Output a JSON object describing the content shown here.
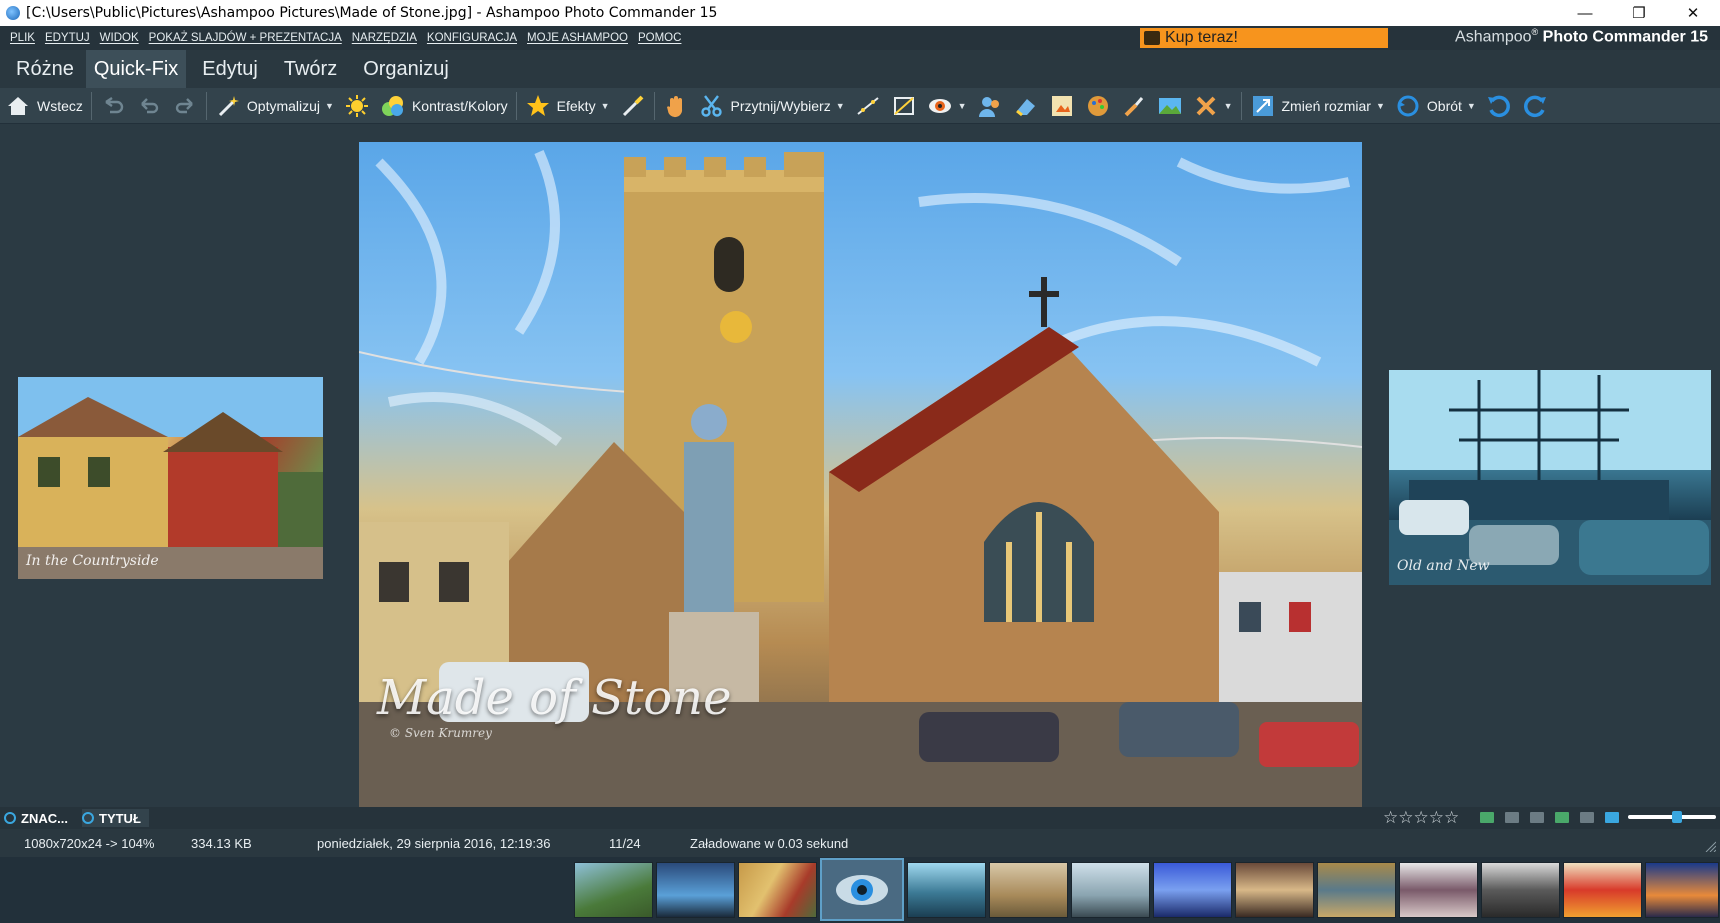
{
  "window": {
    "title": "[C:\\Users\\Public\\Pictures\\Ashampoo Pictures\\Made of Stone.jpg] - Ashampoo Photo Commander 15",
    "minimize": "—",
    "maximize": "❐",
    "close": "✕"
  },
  "menu": [
    "PLIK",
    "EDYTUJ",
    "WIDOK",
    "POKAŻ SLAJDÓW + PREZENTACJA",
    "NARZĘDZIA",
    "KONFIGURACJA",
    "MOJE ASHAMPOO",
    "POMOC"
  ],
  "buy_button": "Kup teraz!",
  "brand": {
    "name": "Ashampoo",
    "mark": "®",
    "product": "Photo Commander 15"
  },
  "tabs": [
    {
      "label": "Różne",
      "active": false
    },
    {
      "label": "Quick-Fix",
      "active": true
    },
    {
      "label": "Edytuj",
      "active": false
    },
    {
      "label": "Twórz",
      "active": false
    },
    {
      "label": "Organizuj",
      "active": false
    }
  ],
  "toolbar": {
    "back": "Wstecz",
    "optimize": "Optymalizuj",
    "contrast": "Kontrast/Kolory",
    "effects": "Efekty",
    "crop": "Przytnij/Wybierz",
    "resize": "Zmień rozmiar",
    "rotate": "Obrót"
  },
  "photo": {
    "watermark_title": "Made of Stone",
    "watermark_author": "© Sven Krumrey",
    "left_caption": "In the Countryside",
    "right_caption": "Old and New"
  },
  "labels": {
    "marks": "ZNAC...",
    "title": "TYTUŁ"
  },
  "rating": {
    "stars": "☆☆☆☆☆"
  },
  "status": {
    "dimensions": "1080x720x24 -> 104%",
    "filesize": "334.13 KB",
    "date": "poniedziałek, 29 sierpnia 2016, 12:19:36",
    "position": "11/24",
    "load_time": "Załadowane w 0.03 sekund"
  },
  "colors": {
    "accent": "#3aa7e0",
    "buy": "#f7941d",
    "background": "#2b3a43"
  }
}
